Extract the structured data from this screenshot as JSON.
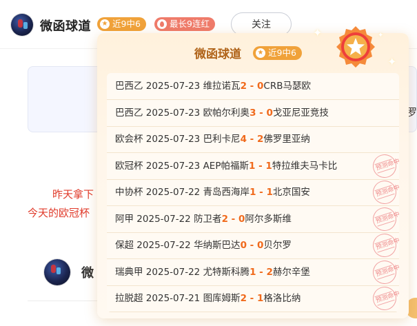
{
  "header": {
    "user_name": "微函球道",
    "badge_recent": "近9中6",
    "badge_streak": "最长9连红",
    "follow_label": "关注"
  },
  "background": {
    "line1": "昨天拿下",
    "line2": "今天的欧冠杯",
    "right_char": "罗",
    "post_user": "微"
  },
  "popup": {
    "title": "微函球道",
    "badge": "近9中6",
    "stamp_text": "预测命中",
    "matches": [
      {
        "league": "巴西乙",
        "date": "2025-07-23",
        "home": "维拉诺瓦",
        "home_score": "2",
        "sep": "-",
        "away_score": "0",
        "away": "CRB马瑟欧",
        "hit": false
      },
      {
        "league": "巴西乙",
        "date": "2025-07-23",
        "home": "欧帕尔利奥",
        "home_score": "3",
        "sep": "-",
        "away_score": "0",
        "away": "戈亚尼亚竞技",
        "hit": false
      },
      {
        "league": "欧会杯",
        "date": "2025-07-23",
        "home": "巴利卡尼",
        "home_score": "4",
        "sep": "-",
        "away_score": "2",
        "away": "佛罗里亚纳",
        "hit": false
      },
      {
        "league": "欧冠杯",
        "date": "2025-07-23",
        "home": "AEP帕福斯",
        "home_score": "1",
        "sep": "-",
        "away_score": "1",
        "away": "特拉维夫马卡比",
        "hit": true
      },
      {
        "league": "中协杯",
        "date": "2025-07-22",
        "home": "青岛西海岸",
        "home_score": "1",
        "sep": "-",
        "away_score": "1",
        "away": "北京国安",
        "hit": true
      },
      {
        "league": "阿甲",
        "date": "2025-07-22",
        "home": "防卫者",
        "home_score": "2",
        "sep": "-",
        "away_score": "0",
        "away": "阿尔多斯维",
        "hit": true
      },
      {
        "league": "保超",
        "date": "2025-07-22",
        "home": "华纳斯巴达",
        "home_score": "0",
        "sep": "-",
        "away_score": "0",
        "away": "贝尔罗",
        "hit": true
      },
      {
        "league": "瑞典甲",
        "date": "2025-07-22",
        "home": "尤特斯科腾",
        "home_score": "1",
        "sep": "-",
        "away_score": "2",
        "away": "赫尔辛堡",
        "hit": true
      },
      {
        "league": "拉脱超",
        "date": "2025-07-21",
        "home": "图库姆斯",
        "home_score": "2",
        "sep": "-",
        "away_score": "1",
        "away": "格洛比纳",
        "hit": true
      }
    ]
  },
  "colors": {
    "accent": "#f06a1c",
    "badge_orange": "#f0a23a",
    "badge_red": "#ef7b6a",
    "title_brown": "#b0641a",
    "stamp": "#ef8b8b"
  },
  "icons": [
    "user-avatar",
    "star-badge-icon",
    "fire-icon",
    "medal-star-icon",
    "sparkle-icon",
    "hit-stamp-icon"
  ]
}
